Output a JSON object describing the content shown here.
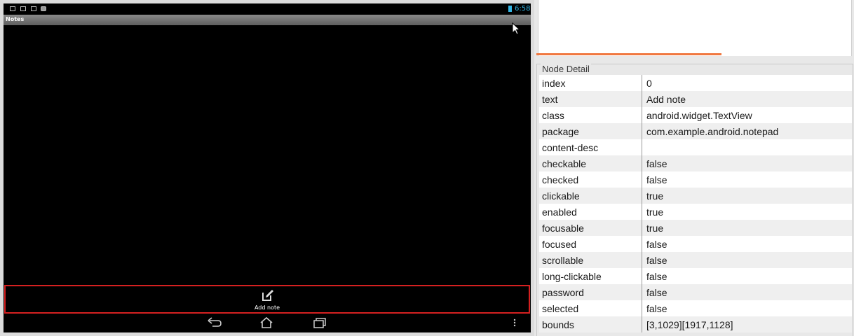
{
  "device": {
    "status_bar": {
      "time": "6:58"
    },
    "action_bar": {
      "title": "Notes"
    },
    "bottom_bar": {
      "add_note_label": "Add note"
    },
    "nav_bar": {
      "buttons": [
        "back-icon",
        "home-icon",
        "recent-apps-icon",
        "overflow-menu-icon"
      ]
    },
    "highlight_color": "#d52020"
  },
  "inspector": {
    "progress_color": "#f07840",
    "node_detail": {
      "title": "Node Detail",
      "rows": [
        {
          "key": "index",
          "value": "0"
        },
        {
          "key": "text",
          "value": "Add note"
        },
        {
          "key": "class",
          "value": "android.widget.TextView"
        },
        {
          "key": "package",
          "value": "com.example.android.notepad"
        },
        {
          "key": "content-desc",
          "value": ""
        },
        {
          "key": "checkable",
          "value": "false"
        },
        {
          "key": "checked",
          "value": "false"
        },
        {
          "key": "clickable",
          "value": "true"
        },
        {
          "key": "enabled",
          "value": "true"
        },
        {
          "key": "focusable",
          "value": "true"
        },
        {
          "key": "focused",
          "value": "false"
        },
        {
          "key": "scrollable",
          "value": "false"
        },
        {
          "key": "long-clickable",
          "value": "false"
        },
        {
          "key": "password",
          "value": "false"
        },
        {
          "key": "selected",
          "value": "false"
        },
        {
          "key": "bounds",
          "value": "[3,1029][1917,1128]"
        }
      ]
    }
  }
}
